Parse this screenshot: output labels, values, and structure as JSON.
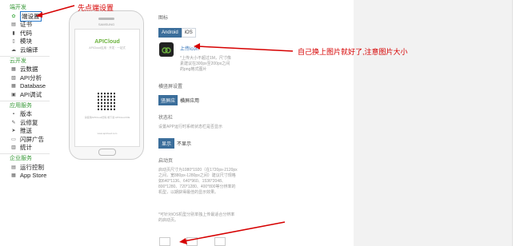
{
  "sidebar": {
    "groups": [
      {
        "title": "端开发",
        "items": [
          {
            "label": "端设置",
            "icon": "gear-icon",
            "active": true
          },
          {
            "label": "证书",
            "icon": "certificate-icon"
          },
          {
            "label": "代码",
            "icon": "code-icon"
          },
          {
            "label": "模块",
            "icon": "module-icon"
          },
          {
            "label": "云编译",
            "icon": "cloud-icon"
          }
        ]
      },
      {
        "title": "云开发",
        "items": [
          {
            "label": "云数据",
            "icon": "database-icon"
          },
          {
            "label": "API分析",
            "icon": "chart-icon"
          },
          {
            "label": "Database",
            "icon": "database-icon"
          },
          {
            "label": "API调试",
            "icon": "api-icon"
          }
        ]
      },
      {
        "title": "应用服务",
        "items": [
          {
            "label": "版本",
            "icon": "version-icon"
          },
          {
            "label": "云修复",
            "icon": "wrench-icon"
          },
          {
            "label": "推送",
            "icon": "push-icon"
          },
          {
            "label": "闪屏广告",
            "icon": "ad-icon"
          },
          {
            "label": "统计",
            "icon": "stats-icon"
          }
        ]
      },
      {
        "title": "企业服务",
        "items": [
          {
            "label": "运行控制",
            "icon": "control-icon"
          },
          {
            "label": "App Store",
            "icon": "store-icon"
          }
        ]
      }
    ]
  },
  "phone": {
    "brand": "SAMSUNG",
    "logo": "APICloud",
    "tagline": "APICloud应用 · 开发 · 一站式",
    "caption": "请使用APICloud扫码\n或下载 APICloud IDE",
    "url": "www.apicloud.com"
  },
  "settings": {
    "icon_title": "图标",
    "platform_tabs": [
      "Android",
      "iOS"
    ],
    "upload_icon_label": "上传icon",
    "icon_hint": "*上传大小不超过1M，尺寸像素建议在300px至200px之间的png格式图片",
    "orientation_title": "横竖屏设置",
    "orientation_options": [
      "竖屏应",
      "横屏应用"
    ],
    "status_title": "状态栏",
    "status_desc": "设置APP运行时系统状态栏是否显示",
    "status_options": [
      "显示",
      "不显示"
    ],
    "launch_title": "启动页",
    "launch_desc": "启动页尺寸为1080*1920（在1720px-2120px之间，宽880px-1280px之间）建议尺寸规格如640*1136、640*960、1536*2048、800*1280、720*1280、400*800等分辨率的机型，以期获得最佳的显示效果。",
    "launch_note": "*可针对iOS机型分别单独上传最适合分辨率的启动页。"
  },
  "annotations": {
    "note1": "先点端设置",
    "note2": "自己换上图片就好了,注意图片大小"
  },
  "colors": {
    "annotation_red": "#d60000",
    "group_green": "#3a9a3a",
    "tab_active_blue": "#3b6e9b"
  }
}
